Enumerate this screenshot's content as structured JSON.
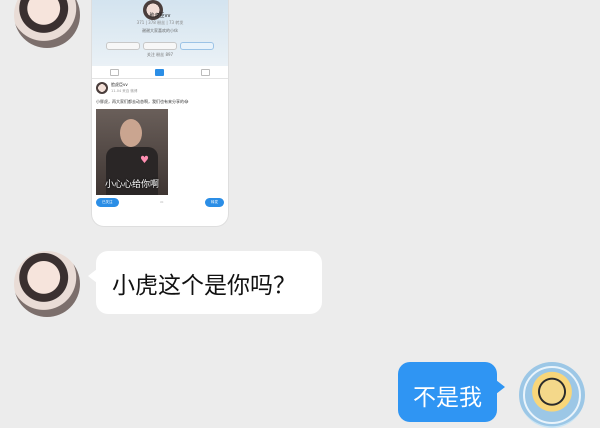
{
  "colors": {
    "background": "#ececec",
    "incoming_bubble": "#ffffff",
    "outgoing_bubble": "#2f95f3"
  },
  "screenshot_card": {
    "profile_name": "脸虎臣vv",
    "profile_stats": "371 | 378 粉丝 | 73 转发",
    "profile_bio": "谢谢大家喜欢的小伙",
    "profile_meta": "关注 粉丝 897",
    "post_user": "脸虎臣vv",
    "post_time": "11-04 来自 微博",
    "post_text": "小胖虎，再大家们都去动态啊，我们也有来分享的😂",
    "image_caption": "小心心给你啊",
    "action_left": "已关注",
    "action_right": "转发"
  },
  "messages": [
    {
      "side": "left",
      "text": "小虎这个是你吗？"
    },
    {
      "side": "right",
      "text": "不是我"
    }
  ]
}
